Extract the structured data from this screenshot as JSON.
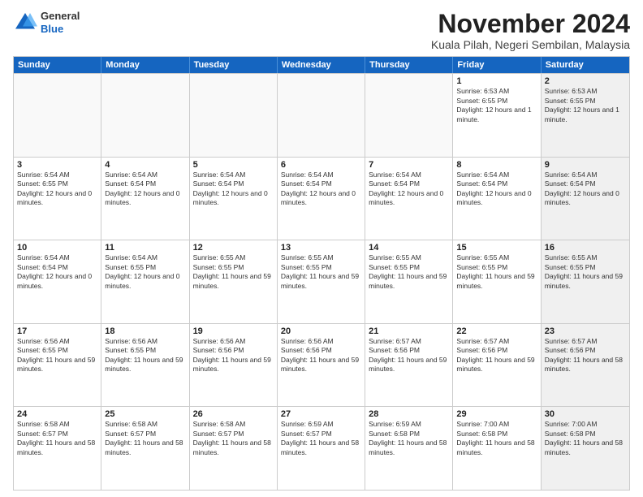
{
  "logo": {
    "general": "General",
    "blue": "Blue"
  },
  "header": {
    "month": "November 2024",
    "location": "Kuala Pilah, Negeri Sembilan, Malaysia"
  },
  "weekdays": [
    "Sunday",
    "Monday",
    "Tuesday",
    "Wednesday",
    "Thursday",
    "Friday",
    "Saturday"
  ],
  "rows": [
    [
      {
        "day": "",
        "info": "",
        "empty": true
      },
      {
        "day": "",
        "info": "",
        "empty": true
      },
      {
        "day": "",
        "info": "",
        "empty": true
      },
      {
        "day": "",
        "info": "",
        "empty": true
      },
      {
        "day": "",
        "info": "",
        "empty": true
      },
      {
        "day": "1",
        "info": "Sunrise: 6:53 AM\nSunset: 6:55 PM\nDaylight: 12 hours and 1 minute.",
        "empty": false,
        "shaded": false
      },
      {
        "day": "2",
        "info": "Sunrise: 6:53 AM\nSunset: 6:55 PM\nDaylight: 12 hours and 1 minute.",
        "empty": false,
        "shaded": true
      }
    ],
    [
      {
        "day": "3",
        "info": "Sunrise: 6:54 AM\nSunset: 6:55 PM\nDaylight: 12 hours and 0 minutes.",
        "empty": false,
        "shaded": false
      },
      {
        "day": "4",
        "info": "Sunrise: 6:54 AM\nSunset: 6:54 PM\nDaylight: 12 hours and 0 minutes.",
        "empty": false,
        "shaded": false
      },
      {
        "day": "5",
        "info": "Sunrise: 6:54 AM\nSunset: 6:54 PM\nDaylight: 12 hours and 0 minutes.",
        "empty": false,
        "shaded": false
      },
      {
        "day": "6",
        "info": "Sunrise: 6:54 AM\nSunset: 6:54 PM\nDaylight: 12 hours and 0 minutes.",
        "empty": false,
        "shaded": false
      },
      {
        "day": "7",
        "info": "Sunrise: 6:54 AM\nSunset: 6:54 PM\nDaylight: 12 hours and 0 minutes.",
        "empty": false,
        "shaded": false
      },
      {
        "day": "8",
        "info": "Sunrise: 6:54 AM\nSunset: 6:54 PM\nDaylight: 12 hours and 0 minutes.",
        "empty": false,
        "shaded": false
      },
      {
        "day": "9",
        "info": "Sunrise: 6:54 AM\nSunset: 6:54 PM\nDaylight: 12 hours and 0 minutes.",
        "empty": false,
        "shaded": true
      }
    ],
    [
      {
        "day": "10",
        "info": "Sunrise: 6:54 AM\nSunset: 6:54 PM\nDaylight: 12 hours and 0 minutes.",
        "empty": false,
        "shaded": false
      },
      {
        "day": "11",
        "info": "Sunrise: 6:54 AM\nSunset: 6:55 PM\nDaylight: 12 hours and 0 minutes.",
        "empty": false,
        "shaded": false
      },
      {
        "day": "12",
        "info": "Sunrise: 6:55 AM\nSunset: 6:55 PM\nDaylight: 11 hours and 59 minutes.",
        "empty": false,
        "shaded": false
      },
      {
        "day": "13",
        "info": "Sunrise: 6:55 AM\nSunset: 6:55 PM\nDaylight: 11 hours and 59 minutes.",
        "empty": false,
        "shaded": false
      },
      {
        "day": "14",
        "info": "Sunrise: 6:55 AM\nSunset: 6:55 PM\nDaylight: 11 hours and 59 minutes.",
        "empty": false,
        "shaded": false
      },
      {
        "day": "15",
        "info": "Sunrise: 6:55 AM\nSunset: 6:55 PM\nDaylight: 11 hours and 59 minutes.",
        "empty": false,
        "shaded": false
      },
      {
        "day": "16",
        "info": "Sunrise: 6:55 AM\nSunset: 6:55 PM\nDaylight: 11 hours and 59 minutes.",
        "empty": false,
        "shaded": true
      }
    ],
    [
      {
        "day": "17",
        "info": "Sunrise: 6:56 AM\nSunset: 6:55 PM\nDaylight: 11 hours and 59 minutes.",
        "empty": false,
        "shaded": false
      },
      {
        "day": "18",
        "info": "Sunrise: 6:56 AM\nSunset: 6:55 PM\nDaylight: 11 hours and 59 minutes.",
        "empty": false,
        "shaded": false
      },
      {
        "day": "19",
        "info": "Sunrise: 6:56 AM\nSunset: 6:56 PM\nDaylight: 11 hours and 59 minutes.",
        "empty": false,
        "shaded": false
      },
      {
        "day": "20",
        "info": "Sunrise: 6:56 AM\nSunset: 6:56 PM\nDaylight: 11 hours and 59 minutes.",
        "empty": false,
        "shaded": false
      },
      {
        "day": "21",
        "info": "Sunrise: 6:57 AM\nSunset: 6:56 PM\nDaylight: 11 hours and 59 minutes.",
        "empty": false,
        "shaded": false
      },
      {
        "day": "22",
        "info": "Sunrise: 6:57 AM\nSunset: 6:56 PM\nDaylight: 11 hours and 59 minutes.",
        "empty": false,
        "shaded": false
      },
      {
        "day": "23",
        "info": "Sunrise: 6:57 AM\nSunset: 6:56 PM\nDaylight: 11 hours and 58 minutes.",
        "empty": false,
        "shaded": true
      }
    ],
    [
      {
        "day": "24",
        "info": "Sunrise: 6:58 AM\nSunset: 6:57 PM\nDaylight: 11 hours and 58 minutes.",
        "empty": false,
        "shaded": false
      },
      {
        "day": "25",
        "info": "Sunrise: 6:58 AM\nSunset: 6:57 PM\nDaylight: 11 hours and 58 minutes.",
        "empty": false,
        "shaded": false
      },
      {
        "day": "26",
        "info": "Sunrise: 6:58 AM\nSunset: 6:57 PM\nDaylight: 11 hours and 58 minutes.",
        "empty": false,
        "shaded": false
      },
      {
        "day": "27",
        "info": "Sunrise: 6:59 AM\nSunset: 6:57 PM\nDaylight: 11 hours and 58 minutes.",
        "empty": false,
        "shaded": false
      },
      {
        "day": "28",
        "info": "Sunrise: 6:59 AM\nSunset: 6:58 PM\nDaylight: 11 hours and 58 minutes.",
        "empty": false,
        "shaded": false
      },
      {
        "day": "29",
        "info": "Sunrise: 7:00 AM\nSunset: 6:58 PM\nDaylight: 11 hours and 58 minutes.",
        "empty": false,
        "shaded": false
      },
      {
        "day": "30",
        "info": "Sunrise: 7:00 AM\nSunset: 6:58 PM\nDaylight: 11 hours and 58 minutes.",
        "empty": false,
        "shaded": true
      }
    ]
  ]
}
